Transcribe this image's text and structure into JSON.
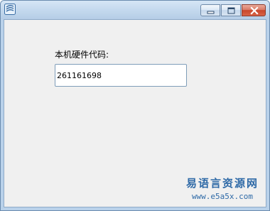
{
  "window": {
    "icon": "app-logo-icon",
    "controls": [
      "minimize-icon",
      "maximize-icon",
      "close-icon"
    ]
  },
  "form": {
    "label": "本机硬件代码:",
    "hardware_code": "261161698"
  },
  "watermark": {
    "title": "易语言资源网",
    "url": "www.e5a5x.com"
  },
  "colors": {
    "titlebar": "#c4d9ee",
    "client_bg": "#f0f0f0",
    "close_button": "#c8472c",
    "watermark": "#2f6aa7"
  }
}
